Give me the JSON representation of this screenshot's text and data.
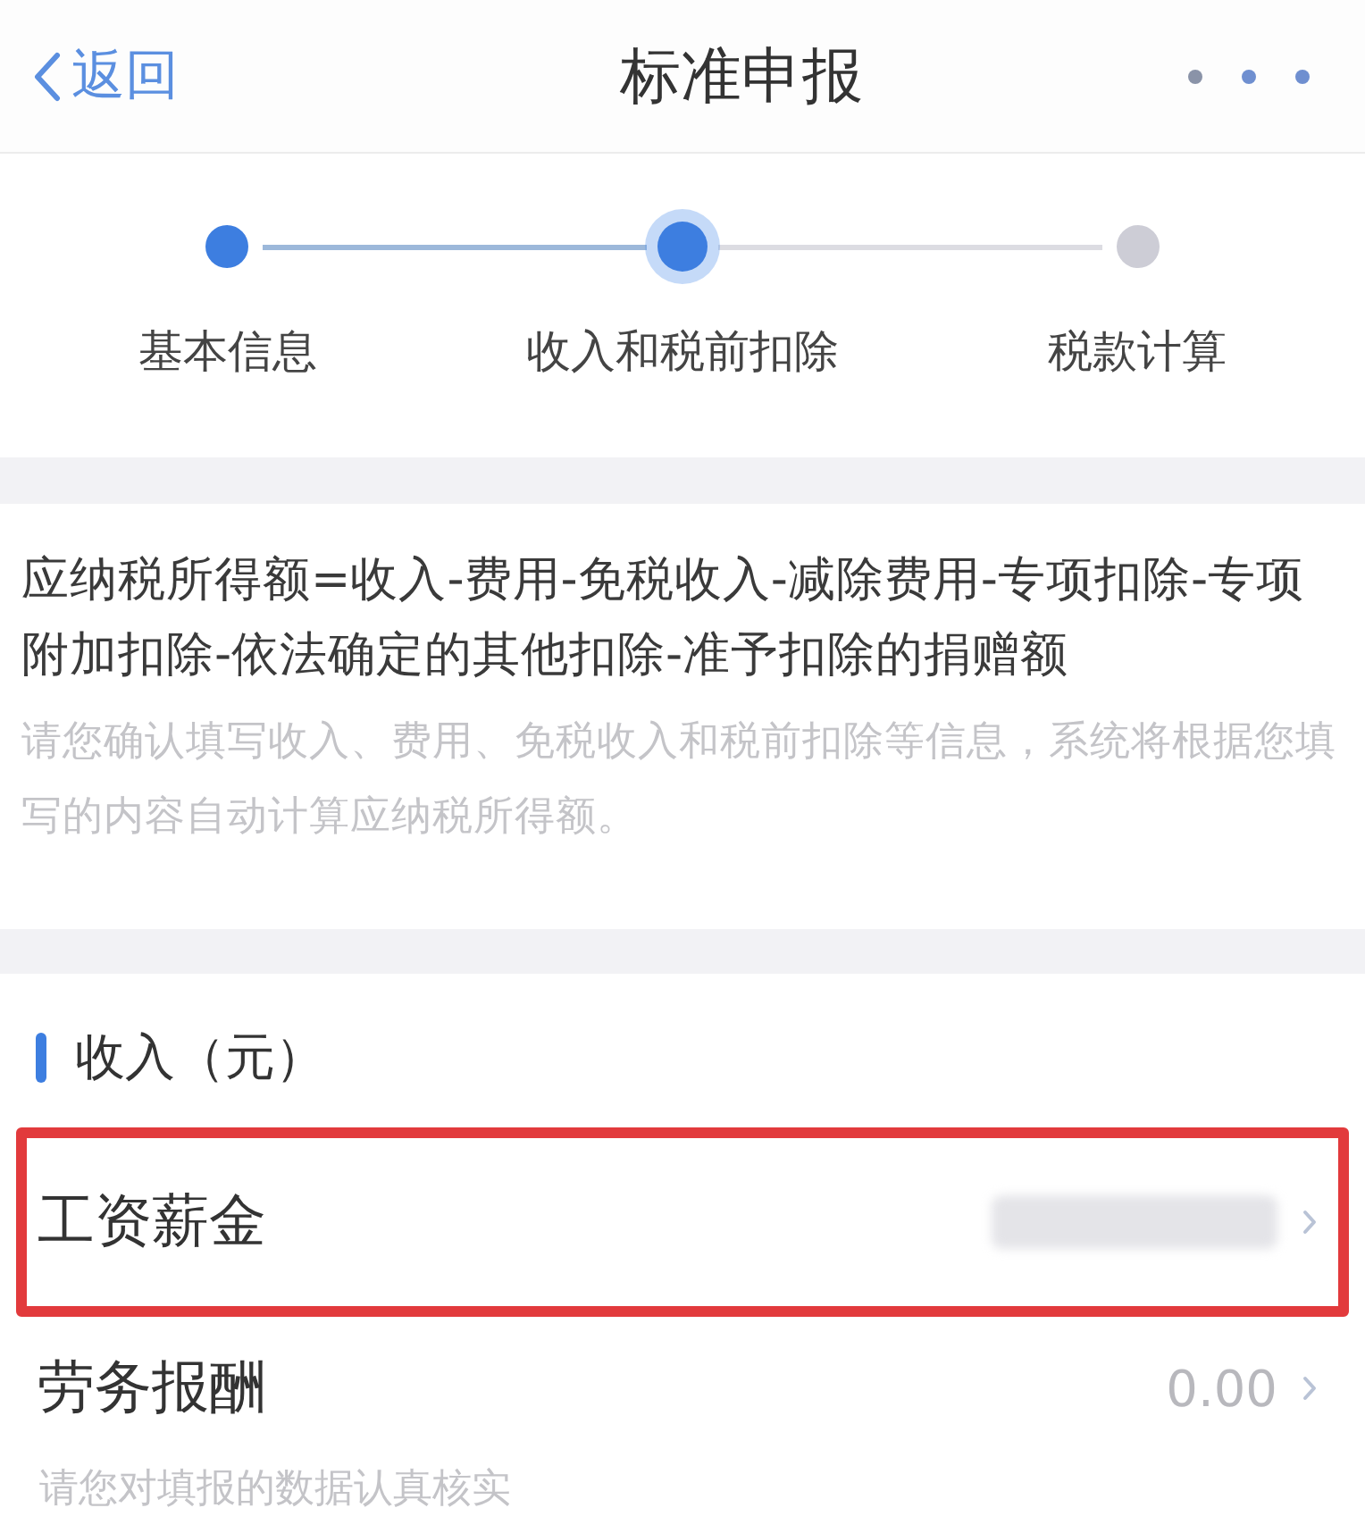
{
  "nav": {
    "back": "返回",
    "title": "标准申报"
  },
  "steps": [
    {
      "label": "基本信息",
      "completed": true,
      "selected": false
    },
    {
      "label": "收入和税前扣除",
      "completed": false,
      "selected": true
    },
    {
      "label": "税款计算",
      "completed": false,
      "selected": false
    }
  ],
  "formula": {
    "text": "应纳税所得额=收入-费用-免税收入-减除费用-专项扣除-专项附加扣除-依法确定的其他扣除-准予扣除的捐赠额",
    "hint": "请您确认填写收入、费用、免税收入和税前扣除等信息，系统将根据您填写的内容自动计算应纳税所得额。"
  },
  "income": {
    "heading": "收入（元）",
    "rows": [
      {
        "label": "工资薪金",
        "redacted": true,
        "highlighted": true
      },
      {
        "label": "劳务报酬",
        "value": "0.00",
        "redacted": false,
        "highlighted": false,
        "note": "请您对填报的数据认真核实"
      }
    ]
  }
}
